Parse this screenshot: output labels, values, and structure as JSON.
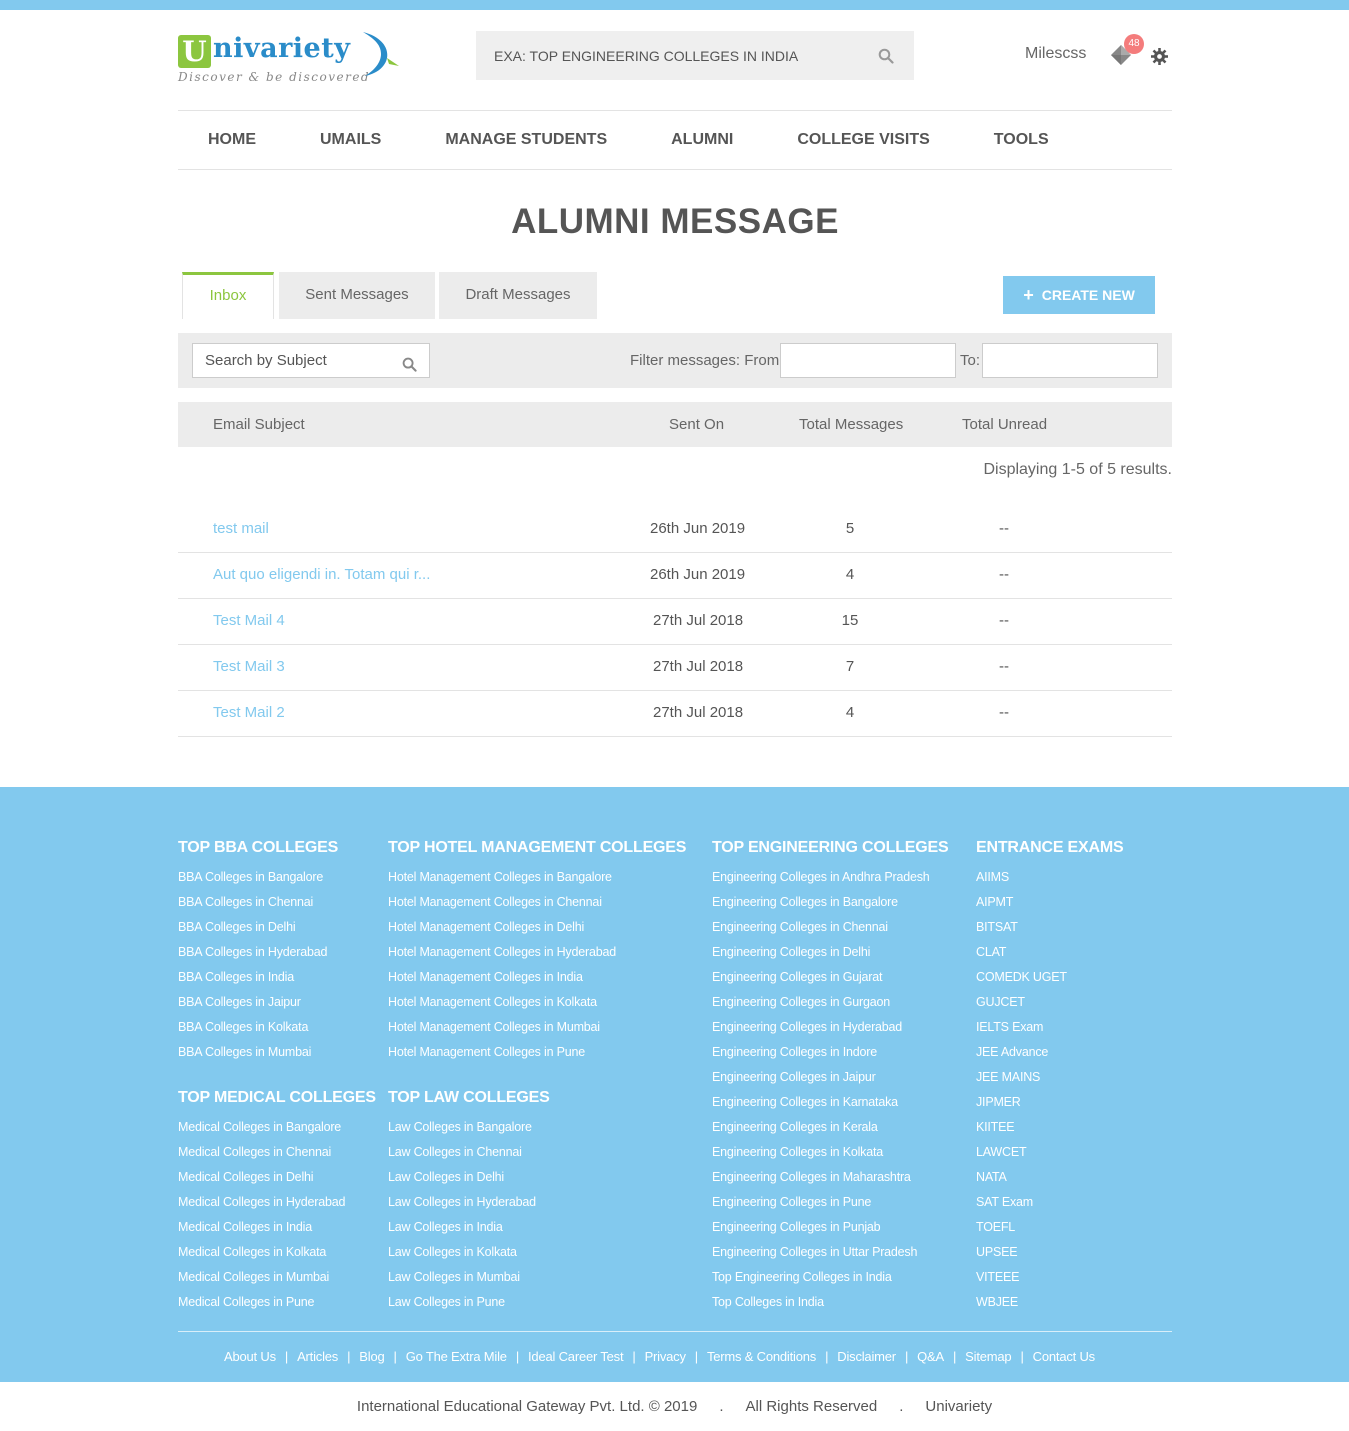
{
  "brand": {
    "logo_letter": "U",
    "logo_text": "nivariety",
    "tagline": "Discover & be discovered"
  },
  "header": {
    "search_placeholder": "EXA: TOP ENGINEERING COLLEGES IN INDIA",
    "user_name": "Milescss",
    "notification_count": "48"
  },
  "nav": [
    "HOME",
    "UMAILS",
    "MANAGE STUDENTS",
    "ALUMNI",
    "COLLEGE VISITS",
    "TOOLS"
  ],
  "page_title": "ALUMNI MESSAGE",
  "tabs": [
    "Inbox",
    "Sent Messages",
    "Draft Messages"
  ],
  "create_button": "CREATE NEW",
  "filter": {
    "subject_placeholder": "Search by Subject",
    "from_label": "Filter messages: From:",
    "to_label": "To:"
  },
  "table": {
    "headers": [
      "Email Subject",
      "Sent On",
      "Total Messages",
      "Total Unread"
    ],
    "display_count": "Displaying 1-5 of 5 results.",
    "rows": [
      {
        "subject": "test mail",
        "sent_on": "26th Jun 2019",
        "total": "5",
        "unread": "--"
      },
      {
        "subject": "Aut quo eligendi in. Totam qui r...",
        "sent_on": "26th Jun 2019",
        "total": "4",
        "unread": "--"
      },
      {
        "subject": "Test Mail 4",
        "sent_on": "27th Jul 2018",
        "total": "15",
        "unread": "--"
      },
      {
        "subject": "Test Mail 3",
        "sent_on": "27th Jul 2018",
        "total": "7",
        "unread": "--"
      },
      {
        "subject": "Test Mail 2",
        "sent_on": "27th Jul 2018",
        "total": "4",
        "unread": "--"
      }
    ]
  },
  "footer": {
    "bba": {
      "title": "TOP BBA COLLEGES",
      "links": [
        "BBA Colleges in Bangalore",
        "BBA Colleges in Chennai",
        "BBA Colleges in Delhi",
        "BBA Colleges in Hyderabad",
        "BBA Colleges in India",
        "BBA Colleges in Jaipur",
        "BBA Colleges in Kolkata",
        "BBA Colleges in Mumbai"
      ]
    },
    "medical": {
      "title": "TOP MEDICAL COLLEGES",
      "links": [
        "Medical Colleges in Bangalore",
        "Medical Colleges in Chennai",
        "Medical Colleges in Delhi",
        "Medical Colleges in Hyderabad",
        "Medical Colleges in India",
        "Medical Colleges in Kolkata",
        "Medical Colleges in Mumbai",
        "Medical Colleges in Pune"
      ]
    },
    "hotel": {
      "title": "TOP HOTEL MANAGEMENT COLLEGES",
      "links": [
        "Hotel Management Colleges in Bangalore",
        "Hotel Management Colleges in Chennai",
        "Hotel Management Colleges in Delhi",
        "Hotel Management Colleges in Hyderabad",
        "Hotel Management Colleges in India",
        "Hotel Management Colleges in Kolkata",
        "Hotel Management Colleges in Mumbai",
        "Hotel Management Colleges in Pune"
      ]
    },
    "law": {
      "title": "TOP LAW COLLEGES",
      "links": [
        "Law Colleges in Bangalore",
        "Law Colleges in Chennai",
        "Law Colleges in Delhi",
        "Law Colleges in Hyderabad",
        "Law Colleges in India",
        "Law Colleges in Kolkata",
        "Law Colleges in Mumbai",
        "Law Colleges in Pune"
      ]
    },
    "engineering": {
      "title": "TOP ENGINEERING COLLEGES",
      "links": [
        "Engineering Colleges in Andhra Pradesh",
        "Engineering Colleges in Bangalore",
        "Engineering Colleges in Chennai",
        "Engineering Colleges in Delhi",
        "Engineering Colleges in Gujarat",
        "Engineering Colleges in Gurgaon",
        "Engineering Colleges in Hyderabad",
        "Engineering Colleges in Indore",
        "Engineering Colleges in Jaipur",
        "Engineering Colleges in Karnataka",
        "Engineering Colleges in Kerala",
        "Engineering Colleges in Kolkata",
        "Engineering Colleges in Maharashtra",
        "Engineering Colleges in Pune",
        "Engineering Colleges in Punjab",
        "Engineering Colleges in Uttar Pradesh",
        "Top Engineering Colleges in India",
        "Top Colleges in India"
      ]
    },
    "exams": {
      "title": "ENTRANCE EXAMS",
      "links": [
        "AIIMS",
        "AIPMT",
        "BITSAT",
        "CLAT",
        "COMEDK UGET",
        "GUJCET",
        "IELTS Exam",
        "JEE Advance",
        "JEE MAINS",
        "JIPMER",
        "KIITEE",
        "LAWCET",
        "NATA",
        "SAT Exam",
        "TOEFL",
        "UPSEE",
        "VITEEE",
        "WBJEE"
      ]
    },
    "bottom_links": [
      "About Us",
      "Articles",
      "Blog",
      "Go The Extra Mile",
      "Ideal Career Test",
      "Privacy",
      "Terms & Conditions",
      "Disclaimer",
      "Q&A",
      "Sitemap",
      "Contact Us"
    ]
  },
  "copyright": {
    "company": "International Educational Gateway Pvt. Ltd. © 2019",
    "rights": "All Rights Reserved",
    "brand": "Univariety"
  },
  "colors": {
    "accent_blue": "#82c9ee",
    "accent_green": "#8cc63f",
    "badge_red": "#f47c7c"
  }
}
